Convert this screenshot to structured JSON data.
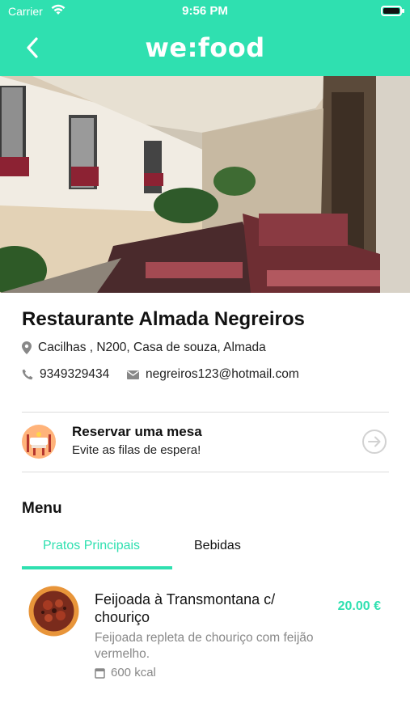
{
  "status_bar": {
    "carrier": "Carrier",
    "time": "9:56 PM"
  },
  "nav": {
    "logo": "we:food",
    "back_icon": "chevron-left-icon"
  },
  "colors": {
    "brand": "#2fe0b0",
    "text": "#111111",
    "muted": "#888888",
    "divider": "#dcdcdc"
  },
  "restaurant": {
    "name": "Restaurante Almada Negreiros",
    "address": "Cacilhas , N200, Casa de souza, Almada",
    "phone": "9349329434",
    "email": "negreiros123@hotmail.com"
  },
  "reservation": {
    "title": "Reservar uma mesa",
    "subtitle": "Evite as filas de espera!"
  },
  "menu": {
    "title": "Menu",
    "tabs": [
      {
        "label": "Pratos Principais",
        "active": true
      },
      {
        "label": "Bebidas",
        "active": false
      }
    ],
    "items": [
      {
        "name": "Feijoada à Transmontana c/ chouriço",
        "price": "20.00 €",
        "description": "Feijoada repleta de chouriço com feijão vermelho.",
        "kcal": "600 kcal"
      }
    ]
  }
}
